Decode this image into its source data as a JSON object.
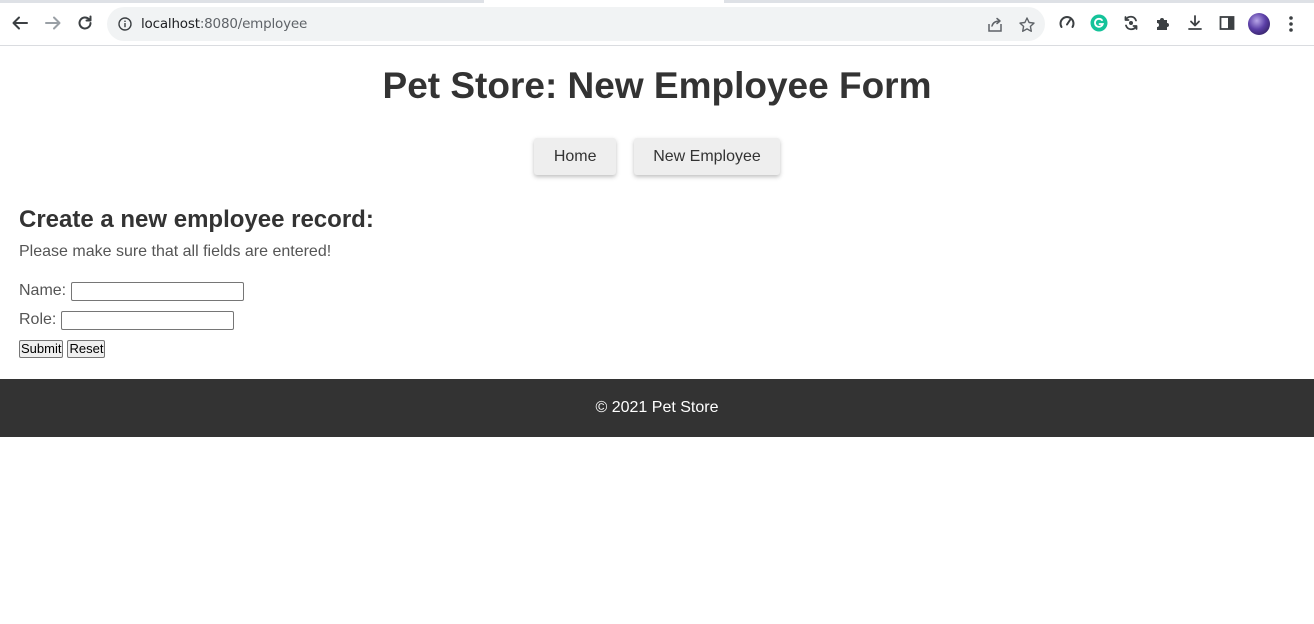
{
  "browser": {
    "url_host": "localhost",
    "url_path": ":8080/employee",
    "icons": {
      "back": "arrow-left-icon",
      "forward": "arrow-right-icon",
      "reload": "reload-icon",
      "info": "info-icon",
      "share": "share-icon",
      "bookmark": "star-icon",
      "extensions": [
        "speed-dial-icon",
        "grammarly-icon",
        "sync-icon",
        "puzzle-icon",
        "download-icon",
        "side-panel-icon"
      ],
      "profile": "avatar",
      "menu": "kebab-menu-icon"
    }
  },
  "page": {
    "title": "Pet Store: New Employee Form",
    "nav": {
      "home_label": "Home",
      "new_employee_label": "New Employee"
    },
    "form": {
      "heading": "Create a new employee record:",
      "instructions": "Please make sure that all fields are entered!",
      "name_label": "Name:",
      "name_value": "",
      "role_label": "Role:",
      "role_value": "",
      "submit_label": "Submit",
      "reset_label": "Reset"
    },
    "footer": {
      "text": "© 2021 Pet Store"
    }
  },
  "colors": {
    "text_dark": "#333333",
    "text_muted": "#555555",
    "nav_button_bg": "#eeeeee",
    "footer_bg": "#333333",
    "footer_text": "#ffffff"
  }
}
